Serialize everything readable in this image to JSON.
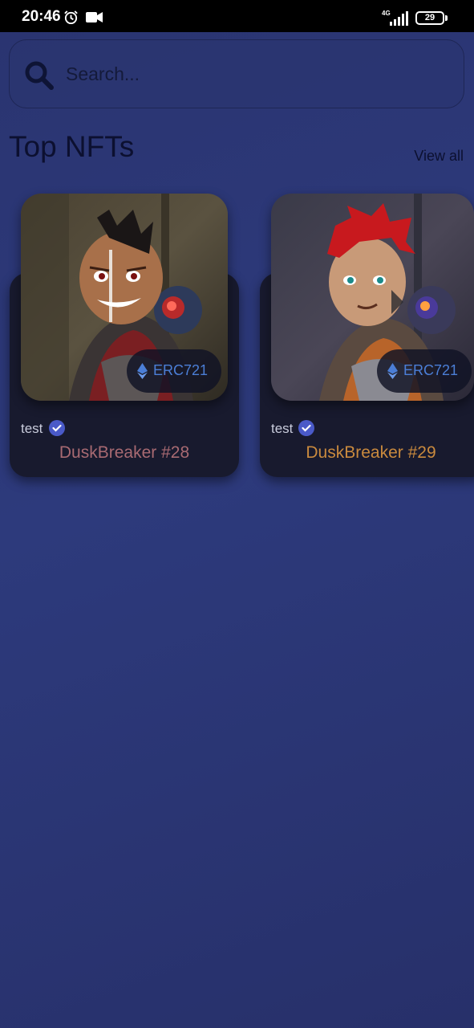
{
  "status_bar": {
    "time": "20:46",
    "network": "4G",
    "battery": "29"
  },
  "search": {
    "placeholder": "Search..."
  },
  "section": {
    "title": "Top NFTs",
    "view_all": "View all"
  },
  "nfts": [
    {
      "owner": "test",
      "name": "DuskBreaker #28",
      "standard": "ERC721",
      "name_color": "#a86a72"
    },
    {
      "owner": "test",
      "name": "DuskBreaker #29",
      "standard": "ERC721",
      "name_color": "#c98a3e"
    }
  ],
  "colors": {
    "background": "#2d3a7c",
    "card": "#181a2e",
    "chip_text": "#4b7ed6",
    "verified_badge": "#4a5ac8"
  }
}
